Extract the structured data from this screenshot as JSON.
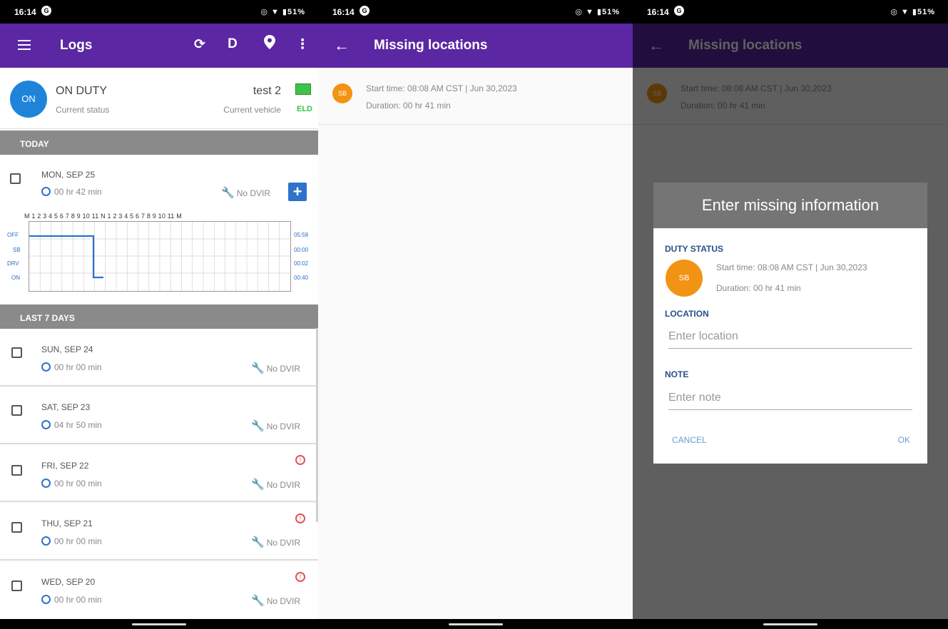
{
  "status_bar": {
    "time": "16:14",
    "g_icon": "G",
    "right": "◎ ▼ ▮51%"
  },
  "logs": {
    "title": "Logs",
    "toolbar": {
      "sync_icon": "⟳",
      "d_label": "D",
      "pin_icon": "📍",
      "more_icon": "⋮"
    },
    "status": {
      "badge": "ON",
      "duty": "ON DUTY",
      "duty_sub": "Current status",
      "vehicle": "test 2",
      "vehicle_sub": "Current vehicle",
      "eld": "ELD"
    },
    "today_header": "TODAY",
    "today": {
      "day": "MON, SEP 25",
      "duration": "00 hr  42 min",
      "dvir": "No DVIR",
      "add": "+"
    },
    "chart_hours": "M 1 2 3 4 5 6 7 8 9 10 11 N 1 2 3 4 5 6 7 8 9 10 11 M",
    "chart_rows": [
      "OFF",
      "SB",
      "DRV",
      "ON"
    ],
    "chart_totals": [
      "05:58",
      "00:00",
      "00:02",
      "00:40"
    ],
    "last7_header": "LAST 7 DAYS",
    "days": [
      {
        "day": "SUN, SEP 24",
        "duration": "00 hr  00 min",
        "dvir": "No DVIR",
        "alert": false
      },
      {
        "day": "SAT, SEP 23",
        "duration": "04 hr  50 min",
        "dvir": "No DVIR",
        "alert": false
      },
      {
        "day": "FRI, SEP 22",
        "duration": "00 hr  00 min",
        "dvir": "No DVIR",
        "alert": true
      },
      {
        "day": "THU, SEP 21",
        "duration": "00 hr  00 min",
        "dvir": "No DVIR",
        "alert": true
      },
      {
        "day": "WED, SEP 20",
        "duration": "00 hr  00 min",
        "dvir": "No DVIR",
        "alert": true
      }
    ]
  },
  "missing": {
    "title": "Missing locations",
    "back": "←",
    "item": {
      "badge": "SB",
      "start": "Start time: 08:08 AM CST | Jun 30,2023",
      "duration": "Duration: 00 hr  41 min"
    }
  },
  "dialog": {
    "title": "Enter missing information",
    "duty_label": "DUTY STATUS",
    "badge": "SB",
    "start": "Start time: 08:08 AM CST | Jun 30,2023",
    "duration": "Duration: 00 hr  41 min",
    "location_label": "LOCATION",
    "location_placeholder": "Enter location",
    "note_label": "NOTE",
    "note_placeholder": "Enter note",
    "cancel": "CANCEL",
    "ok": "OK"
  },
  "colors": {
    "appbar": "#5b27a3",
    "accent_blue": "#1f84d9",
    "sb_orange": "#f39313",
    "eld_green": "#3fc24a",
    "alert_red": "#e05555"
  }
}
